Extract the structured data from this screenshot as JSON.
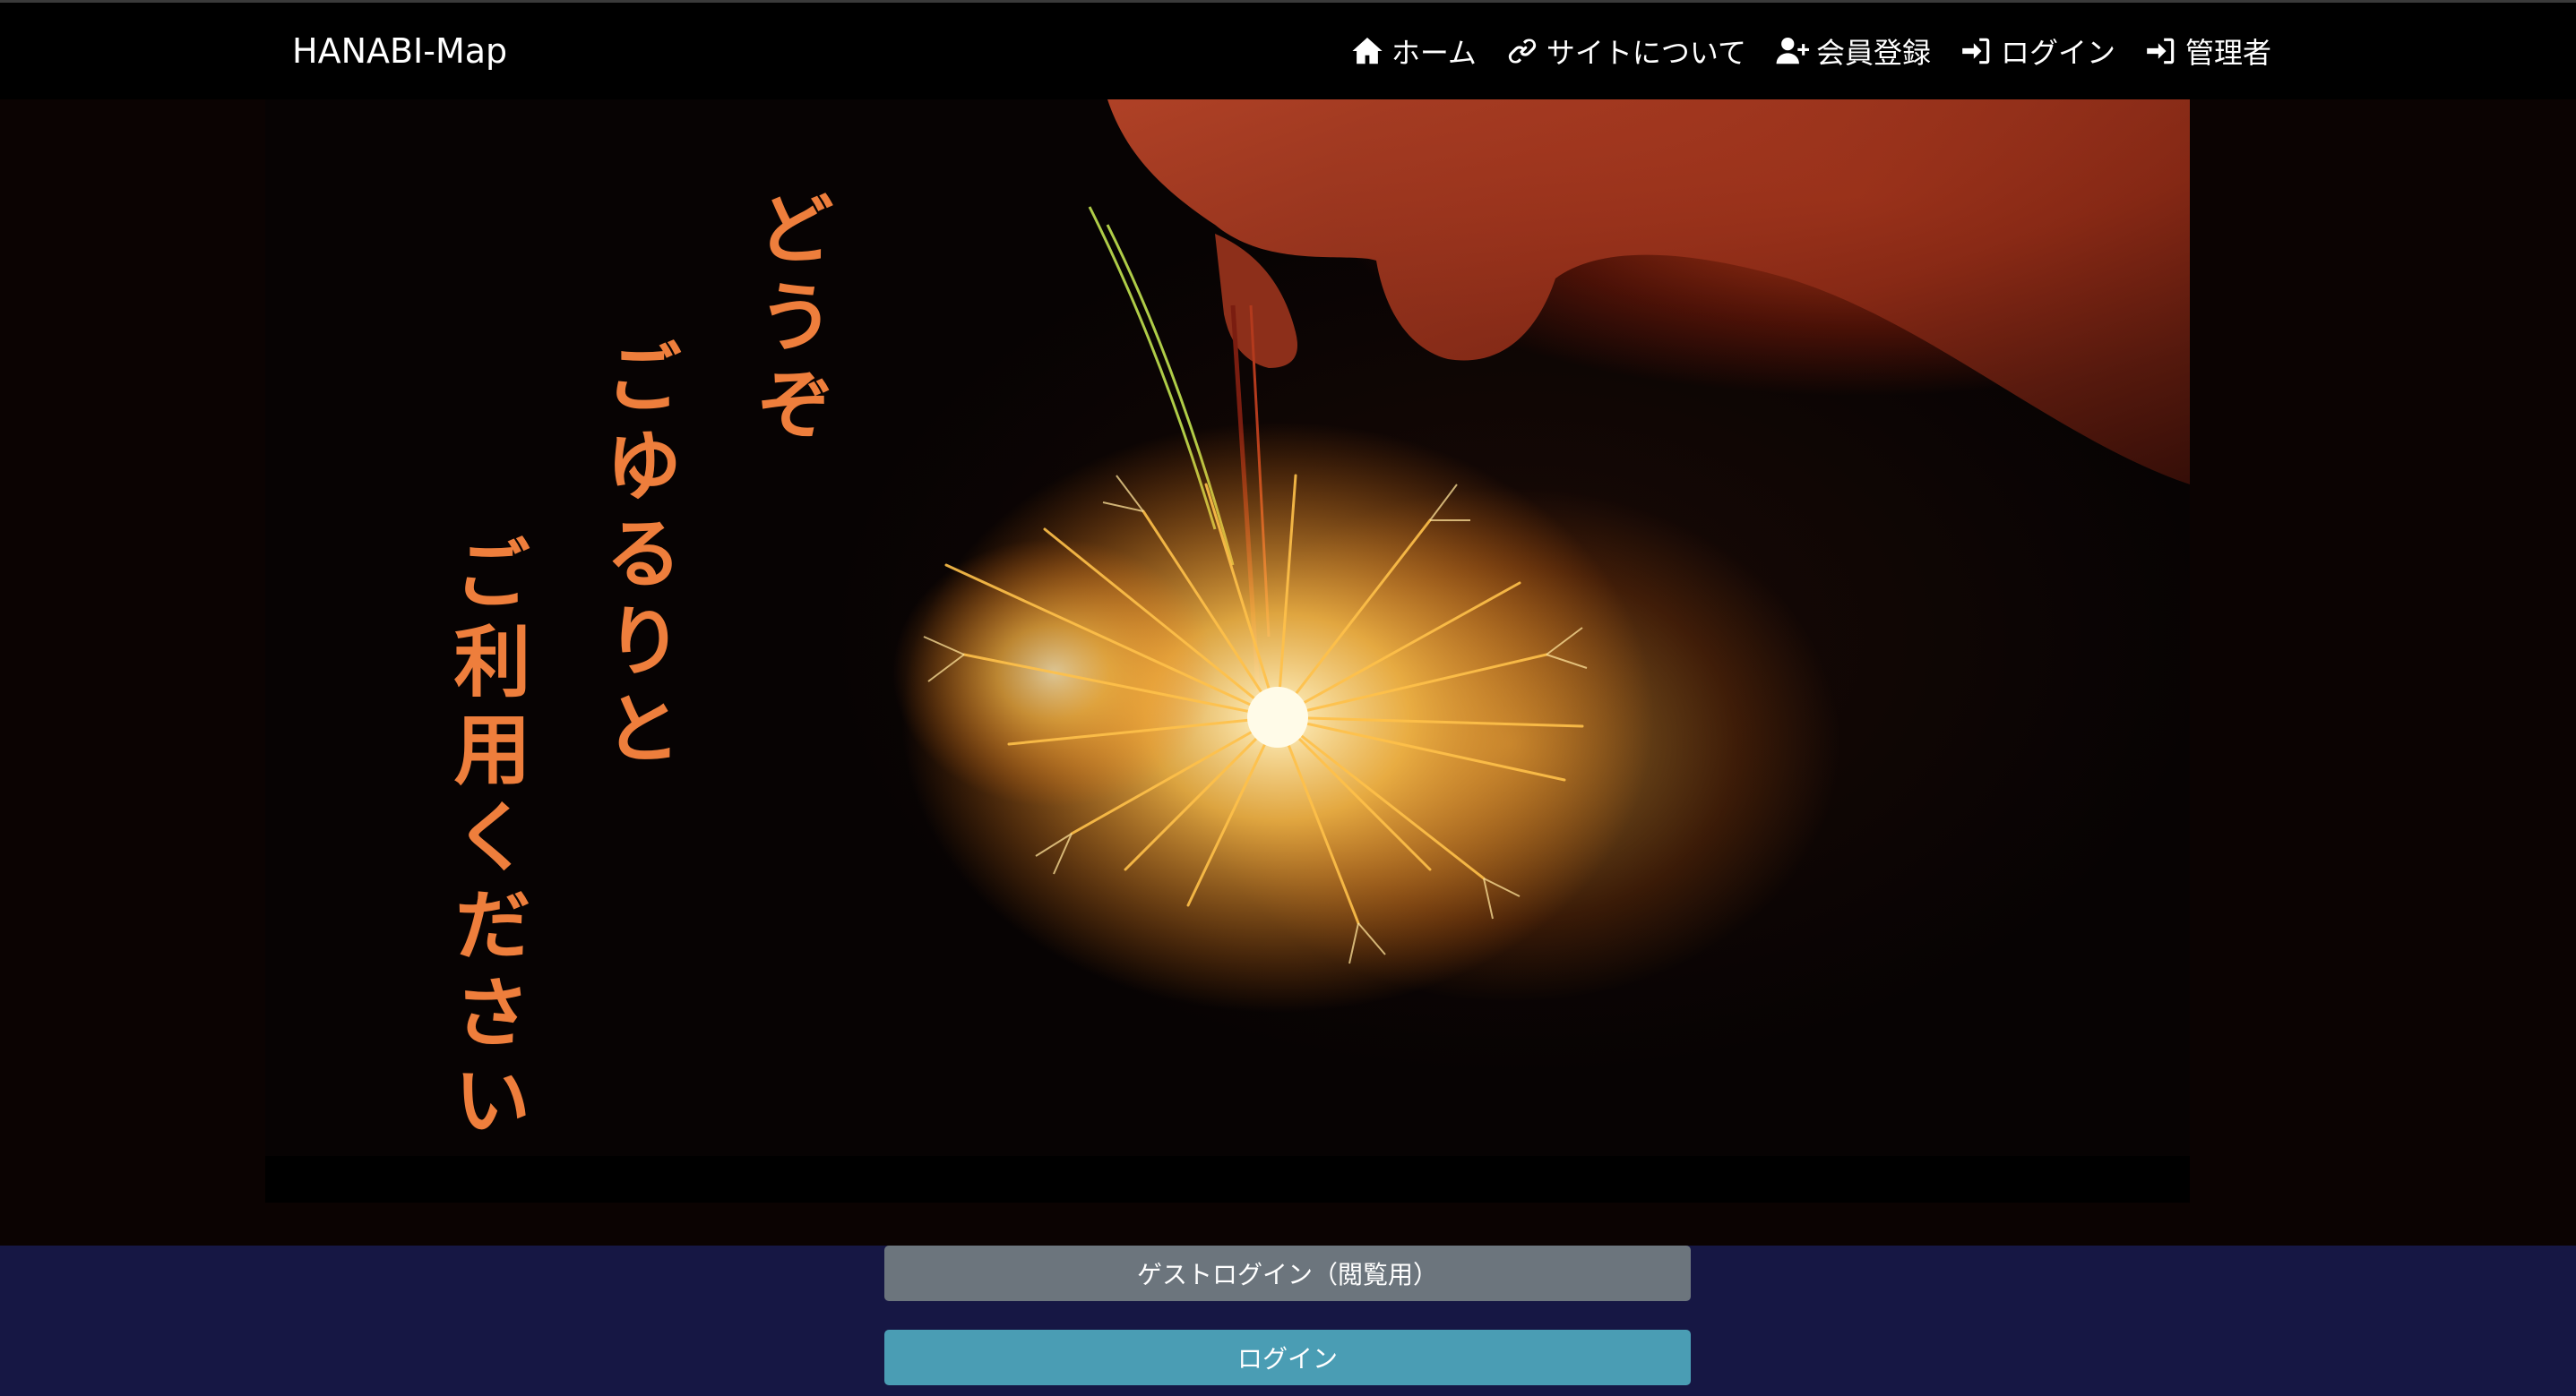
{
  "navbar": {
    "brand": "HANABI-Map",
    "items": [
      {
        "label": "ホーム",
        "icon": "home-icon"
      },
      {
        "label": "サイトについて",
        "icon": "link-icon"
      },
      {
        "label": "会員登録",
        "icon": "user-plus-icon"
      },
      {
        "label": "ログイン",
        "icon": "sign-in-icon"
      },
      {
        "label": "管理者",
        "icon": "sign-in-icon"
      }
    ]
  },
  "hero": {
    "lines": [
      "どうぞ",
      "ごゆるりと",
      "ご利用ください"
    ],
    "text_color": "#ee7e3c"
  },
  "actions": {
    "guest_login": "ゲストログイン（閲覧用）",
    "login": "ログイン"
  },
  "colors": {
    "navbar_bg": "#000000",
    "bottom_bg": "#161744",
    "guest_button": "#6c757d",
    "login_button": "#4a9db4"
  }
}
